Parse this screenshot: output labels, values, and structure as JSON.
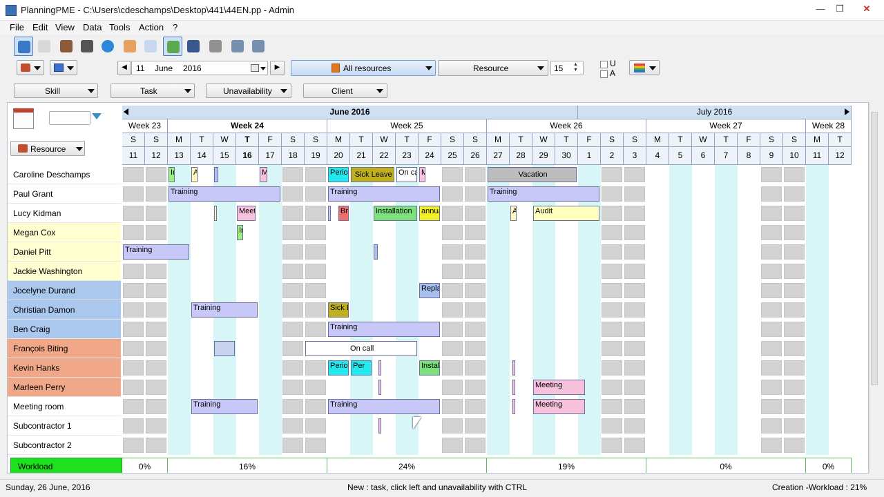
{
  "window": {
    "title": "PlanningPME - C:\\Users\\cdeschamps\\Desktop\\441\\44EN.pp - Admin",
    "minimize": "—",
    "maximize": "❐",
    "close": "✕"
  },
  "menu": [
    "File",
    "Edit",
    "View",
    "Data",
    "Tools",
    "Action",
    "?"
  ],
  "toolbar_icons": [
    "resource-view-icon",
    "task-list-icon",
    "resource-group-icon",
    "book-icon",
    "globe-icon",
    "calendar-icon",
    "table-icon",
    "add-task-icon",
    "scheduler-icon",
    "tools-icon",
    "export-icon",
    "import-icon"
  ],
  "date_nav": {
    "day": "11",
    "month": "June",
    "year": "2016",
    "prev": "◀",
    "next": "▶"
  },
  "resources_filter": "All resources",
  "view_mode": "Resource",
  "rows_count": "15",
  "checkbox_u": "U",
  "checkbox_a": "A",
  "filters": [
    "Skill",
    "Task",
    "Unavailability",
    "Client"
  ],
  "grid": {
    "resource_header": "Resource",
    "months": [
      {
        "label": "June 2016",
        "days": 20
      },
      {
        "label": "July 2016",
        "days": 12
      }
    ],
    "weeks": [
      {
        "label": "Week 23",
        "days": 2,
        "bold": false
      },
      {
        "label": "Week 24",
        "days": 7,
        "bold": true
      },
      {
        "label": "Week 25",
        "days": 7,
        "bold": false
      },
      {
        "label": "Week 26",
        "days": 7,
        "bold": false
      },
      {
        "label": "Week 27",
        "days": 7,
        "bold": false
      },
      {
        "label": "Week 28",
        "days": 2,
        "bold": false
      }
    ],
    "day_letters": [
      "S",
      "S",
      "M",
      "T",
      "W",
      "T",
      "F",
      "S",
      "S",
      "M",
      "T",
      "W",
      "T",
      "F",
      "S",
      "S",
      "M",
      "T",
      "W",
      "T",
      "F",
      "S",
      "S",
      "M",
      "T",
      "W",
      "T",
      "F",
      "S",
      "S",
      "M",
      "T"
    ],
    "day_numbers": [
      "11",
      "12",
      "13",
      "14",
      "15",
      "16",
      "17",
      "18",
      "19",
      "20",
      "21",
      "22",
      "23",
      "24",
      "25",
      "26",
      "27",
      "28",
      "29",
      "30",
      "1",
      "2",
      "3",
      "4",
      "5",
      "6",
      "7",
      "8",
      "9",
      "10",
      "11",
      "12"
    ],
    "today_index": 5,
    "resources": [
      {
        "name": "Caroline Deschamps",
        "color": "#ffffff"
      },
      {
        "name": "Paul Grant",
        "color": "#ffffff"
      },
      {
        "name": "Lucy Kidman",
        "color": "#ffffff"
      },
      {
        "name": "Megan Cox",
        "color": "#ffffd2"
      },
      {
        "name": "Daniel Pitt",
        "color": "#ffffd2"
      },
      {
        "name": "Jackie Washington",
        "color": "#ffffd2"
      },
      {
        "name": "Jocelyne Durand",
        "color": "#aac8ee"
      },
      {
        "name": "Christian Damon",
        "color": "#aac8ee"
      },
      {
        "name": "Ben Craig",
        "color": "#aac8ee"
      },
      {
        "name": "François Biting",
        "color": "#f0a888"
      },
      {
        "name": "Kevin Hanks",
        "color": "#f0a888"
      },
      {
        "name": "Marleen Perry",
        "color": "#f0a888"
      },
      {
        "name": "Meeting room",
        "color": "#ffffff"
      },
      {
        "name": "Subcontractor 1",
        "color": "#ffffff"
      },
      {
        "name": "Subcontractor 2",
        "color": "#ffffff"
      }
    ],
    "tasks": [
      {
        "row": 0,
        "start": 2,
        "span": 0.3,
        "label": "Ir",
        "color": "#9cf07c"
      },
      {
        "row": 0,
        "start": 3,
        "span": 0.3,
        "label": "A",
        "color": "#fffab8"
      },
      {
        "row": 0,
        "start": 4,
        "span": 0.2,
        "label": "",
        "color": "#b0c0f0"
      },
      {
        "row": 0,
        "start": 6,
        "span": 0.35,
        "label": "M",
        "color": "#f8c2dc"
      },
      {
        "row": 0,
        "start": 9,
        "span": 0.95,
        "label": "Period",
        "color": "#22e8f0"
      },
      {
        "row": 0,
        "start": 10,
        "span": 1.95,
        "label": "Sick Leave",
        "color": "#c0b020"
      },
      {
        "row": 0,
        "start": 12,
        "span": 0.95,
        "label": "On ca",
        "color": "#ffffff"
      },
      {
        "row": 0,
        "start": 13,
        "span": 0.3,
        "label": "M",
        "color": "#f8c2dc"
      },
      {
        "row": 0,
        "start": 16,
        "span": 3.95,
        "label": "Vacation",
        "color": "#bcbcbc"
      },
      {
        "row": 1,
        "start": 2,
        "span": 4.95,
        "label": "Training",
        "color": "#c8c8f8"
      },
      {
        "row": 1,
        "start": 9,
        "span": 4.95,
        "label": "Training",
        "color": "#c8c8f8"
      },
      {
        "row": 1,
        "start": 16,
        "span": 4.95,
        "label": "Training",
        "color": "#c8c8f8"
      },
      {
        "row": 2,
        "start": 4,
        "span": 0.15,
        "label": "",
        "color": "#fffab8"
      },
      {
        "row": 2,
        "start": 5,
        "span": 0.85,
        "label": "Meet",
        "color": "#f8c2dc"
      },
      {
        "row": 2,
        "start": 9,
        "span": 0.08,
        "label": "",
        "color": "#c8c8f8"
      },
      {
        "row": 2,
        "start": 9.45,
        "span": 0.5,
        "label": "Br",
        "color": "#f07070"
      },
      {
        "row": 2,
        "start": 11,
        "span": 1.95,
        "label": "Installation",
        "color": "#7ce07c"
      },
      {
        "row": 2,
        "start": 13,
        "span": 0.95,
        "label": "annua",
        "color": "#f0f028"
      },
      {
        "row": 2,
        "start": 17,
        "span": 0.3,
        "label": "A",
        "color": "#fffab8"
      },
      {
        "row": 2,
        "start": 18,
        "span": 2.95,
        "label": "Audit",
        "color": "#ffffbe"
      },
      {
        "row": 3,
        "start": 5,
        "span": 0.3,
        "label": "Ir",
        "color": "#9cf07c"
      },
      {
        "row": 4,
        "start": 0,
        "span": 2.95,
        "label": "Training",
        "color": "#c8c8f8"
      },
      {
        "row": 4,
        "start": 11,
        "span": 0.2,
        "label": "",
        "color": "#a8c0f0"
      },
      {
        "row": 6,
        "start": 13,
        "span": 0.95,
        "label": "Repla",
        "color": "#a8c0f0"
      },
      {
        "row": 7,
        "start": 3,
        "span": 2.95,
        "label": "Training",
        "color": "#c8c8f8"
      },
      {
        "row": 7,
        "start": 9,
        "span": 0.95,
        "label": "Sick Le",
        "color": "#c0b020"
      },
      {
        "row": 8,
        "start": 9,
        "span": 4.95,
        "label": "Training",
        "color": "#c8c8f8"
      },
      {
        "row": 9,
        "start": 4,
        "span": 0.95,
        "label": "",
        "color": "#c8d4ee"
      },
      {
        "row": 9,
        "start": 8,
        "span": 4.95,
        "label": "On call",
        "color": "#ffffff"
      },
      {
        "row": 10,
        "start": 9,
        "span": 0.95,
        "label": "Period",
        "color": "#22e8f0"
      },
      {
        "row": 10,
        "start": 10,
        "span": 0.95,
        "label": "Per",
        "color": "#22e8f0"
      },
      {
        "row": 10,
        "start": 11.2,
        "span": 0.15,
        "label": "",
        "color": "#f8c2dc"
      },
      {
        "row": 10,
        "start": 13,
        "span": 0.95,
        "label": "Instal",
        "color": "#7ce07c"
      },
      {
        "row": 10,
        "start": 17.1,
        "span": 0.15,
        "label": "",
        "color": "#f8c2dc"
      },
      {
        "row": 11,
        "start": 11.2,
        "span": 0.15,
        "label": "",
        "color": "#f8c2dc"
      },
      {
        "row": 11,
        "start": 17.1,
        "span": 0.15,
        "label": "",
        "color": "#f8c2dc"
      },
      {
        "row": 11,
        "start": 18,
        "span": 2.3,
        "label": "Meeting",
        "color": "#f8c2dc"
      },
      {
        "row": 12,
        "start": 3,
        "span": 2.95,
        "label": "Training",
        "color": "#c8c8f8"
      },
      {
        "row": 12,
        "start": 9,
        "span": 4.95,
        "label": "Training",
        "color": "#c8c8f8"
      },
      {
        "row": 12,
        "start": 17.1,
        "span": 0.15,
        "label": "",
        "color": "#f8c2dc"
      },
      {
        "row": 12,
        "start": 18,
        "span": 2.3,
        "label": "Meeting",
        "color": "#f8c2dc"
      },
      {
        "row": 13,
        "start": 11.2,
        "span": 0.15,
        "label": "",
        "color": "#f8c2dc"
      }
    ],
    "workload": {
      "label": "Workload",
      "values": [
        {
          "text": "0%",
          "days": 2
        },
        {
          "text": "16%",
          "days": 7
        },
        {
          "text": "24%",
          "days": 7
        },
        {
          "text": "19%",
          "days": 7
        },
        {
          "text": "0%",
          "days": 7
        },
        {
          "text": "0%",
          "days": 2
        }
      ]
    }
  },
  "status": {
    "date": "Sunday, 26 June, 2016",
    "hint": "New : task, click left and unavailability with CTRL",
    "creation": "Creation -Workload : 21%"
  }
}
